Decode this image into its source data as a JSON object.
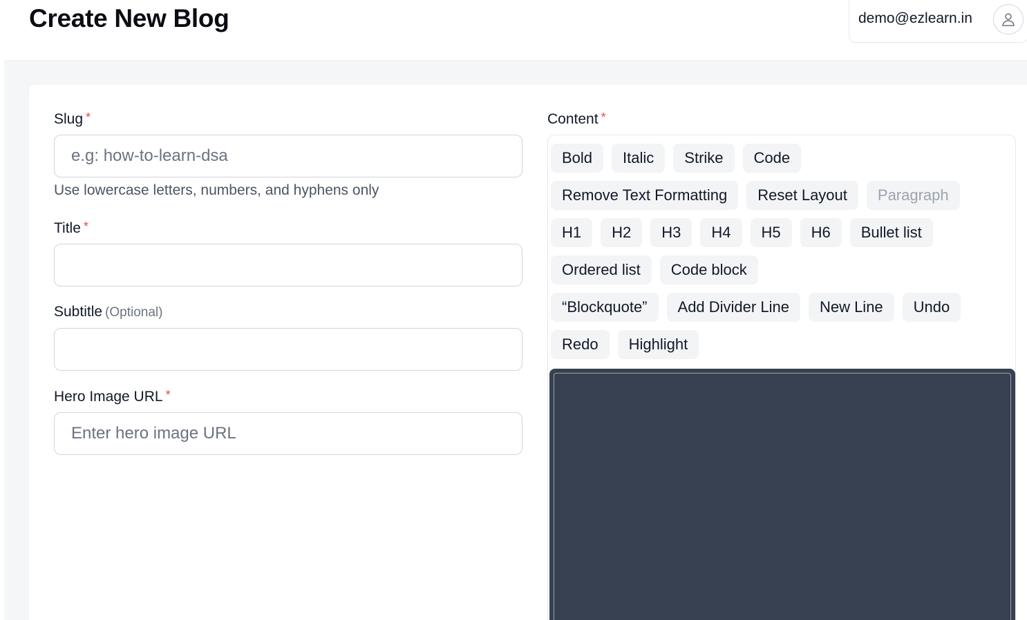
{
  "header": {
    "title": "Create New Blog",
    "user_email": "demo@ezlearn.in",
    "avatar_icon": "user-icon"
  },
  "form": {
    "slug": {
      "label": "Slug",
      "required_mark": "*",
      "placeholder": "e.g: how-to-learn-dsa",
      "value": "",
      "helper": "Use lowercase letters, numbers, and hyphens only"
    },
    "title": {
      "label": "Title",
      "required_mark": "*",
      "placeholder": "",
      "value": ""
    },
    "subtitle": {
      "label": "Subtitle",
      "optional_text": "(Optional)",
      "placeholder": "",
      "value": ""
    },
    "hero_image": {
      "label": "Hero Image URL",
      "required_mark": "*",
      "placeholder": "Enter hero image URL",
      "value": ""
    }
  },
  "content": {
    "label": "Content",
    "required_mark": "*",
    "toolbar": {
      "bold": "Bold",
      "italic": "Italic",
      "strike": "Strike",
      "code": "Code",
      "remove_formatting": "Remove Text Formatting",
      "reset_layout": "Reset Layout",
      "paragraph": "Paragraph",
      "h1": "H1",
      "h2": "H2",
      "h3": "H3",
      "h4": "H4",
      "h5": "H5",
      "h6": "H6",
      "bullet_list": "Bullet list",
      "ordered_list": "Ordered list",
      "code_block": "Code block",
      "blockquote": "“Blockquote”",
      "divider": "Add Divider Line",
      "new_line": "New Line",
      "undo": "Undo",
      "redo": "Redo",
      "highlight": "Highlight"
    }
  },
  "colors": {
    "accent_required": "#ef4444",
    "editor_background": "#374151",
    "page_background": "#f5f6f8"
  }
}
